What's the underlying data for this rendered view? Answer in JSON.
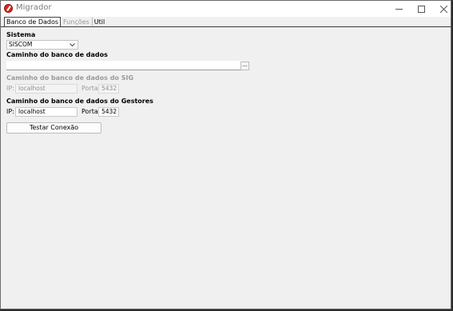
{
  "window": {
    "title": "Migrador"
  },
  "tabs": [
    {
      "label": "Banco de Dados"
    },
    {
      "label": "Funções"
    },
    {
      "label": "Util"
    }
  ],
  "sistema": {
    "label": "Sistema",
    "selected": "SISCOM"
  },
  "caminho": {
    "label": "Caminho do banco de dados",
    "value": "",
    "browse_label": "..."
  },
  "sig": {
    "label": "Caminho do banco de dados do SIG",
    "ip_label": "IP:",
    "ip_value": "localhost",
    "porta_label": "Porta:",
    "porta_value": "5432"
  },
  "gestores": {
    "label": "Caminho do banco de dados do Gestores",
    "ip_label": "IP:",
    "ip_value": "localhost",
    "porta_label": "Porta:",
    "porta_value": "5432"
  },
  "actions": {
    "test_label": "Testar Conexão"
  }
}
